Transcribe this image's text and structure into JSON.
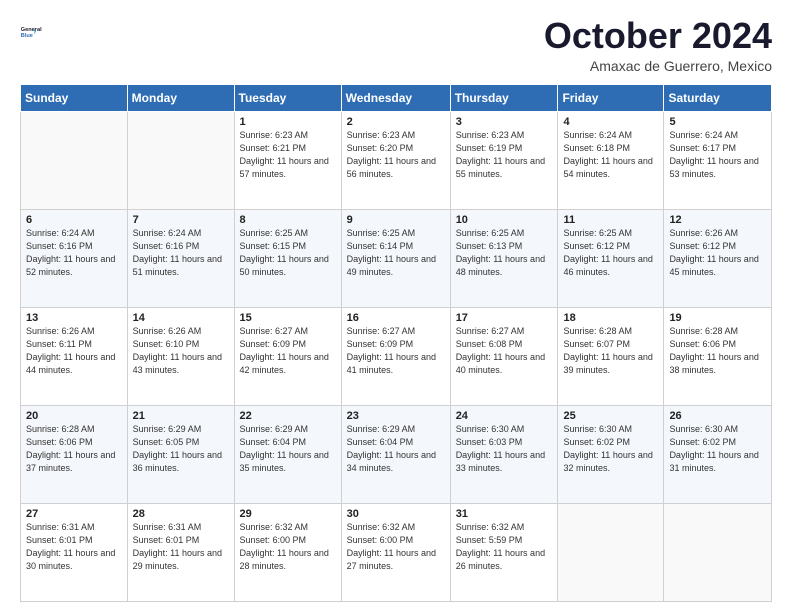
{
  "header": {
    "logo_line1": "General",
    "logo_line2": "Blue",
    "title": "October 2024",
    "subtitle": "Amaxac de Guerrero, Mexico"
  },
  "columns": [
    "Sunday",
    "Monday",
    "Tuesday",
    "Wednesday",
    "Thursday",
    "Friday",
    "Saturday"
  ],
  "weeks": [
    [
      {
        "day": "",
        "sunrise": "",
        "sunset": "",
        "daylight": ""
      },
      {
        "day": "",
        "sunrise": "",
        "sunset": "",
        "daylight": ""
      },
      {
        "day": "1",
        "sunrise": "Sunrise: 6:23 AM",
        "sunset": "Sunset: 6:21 PM",
        "daylight": "Daylight: 11 hours and 57 minutes."
      },
      {
        "day": "2",
        "sunrise": "Sunrise: 6:23 AM",
        "sunset": "Sunset: 6:20 PM",
        "daylight": "Daylight: 11 hours and 56 minutes."
      },
      {
        "day": "3",
        "sunrise": "Sunrise: 6:23 AM",
        "sunset": "Sunset: 6:19 PM",
        "daylight": "Daylight: 11 hours and 55 minutes."
      },
      {
        "day": "4",
        "sunrise": "Sunrise: 6:24 AM",
        "sunset": "Sunset: 6:18 PM",
        "daylight": "Daylight: 11 hours and 54 minutes."
      },
      {
        "day": "5",
        "sunrise": "Sunrise: 6:24 AM",
        "sunset": "Sunset: 6:17 PM",
        "daylight": "Daylight: 11 hours and 53 minutes."
      }
    ],
    [
      {
        "day": "6",
        "sunrise": "Sunrise: 6:24 AM",
        "sunset": "Sunset: 6:16 PM",
        "daylight": "Daylight: 11 hours and 52 minutes."
      },
      {
        "day": "7",
        "sunrise": "Sunrise: 6:24 AM",
        "sunset": "Sunset: 6:16 PM",
        "daylight": "Daylight: 11 hours and 51 minutes."
      },
      {
        "day": "8",
        "sunrise": "Sunrise: 6:25 AM",
        "sunset": "Sunset: 6:15 PM",
        "daylight": "Daylight: 11 hours and 50 minutes."
      },
      {
        "day": "9",
        "sunrise": "Sunrise: 6:25 AM",
        "sunset": "Sunset: 6:14 PM",
        "daylight": "Daylight: 11 hours and 49 minutes."
      },
      {
        "day": "10",
        "sunrise": "Sunrise: 6:25 AM",
        "sunset": "Sunset: 6:13 PM",
        "daylight": "Daylight: 11 hours and 48 minutes."
      },
      {
        "day": "11",
        "sunrise": "Sunrise: 6:25 AM",
        "sunset": "Sunset: 6:12 PM",
        "daylight": "Daylight: 11 hours and 46 minutes."
      },
      {
        "day": "12",
        "sunrise": "Sunrise: 6:26 AM",
        "sunset": "Sunset: 6:12 PM",
        "daylight": "Daylight: 11 hours and 45 minutes."
      }
    ],
    [
      {
        "day": "13",
        "sunrise": "Sunrise: 6:26 AM",
        "sunset": "Sunset: 6:11 PM",
        "daylight": "Daylight: 11 hours and 44 minutes."
      },
      {
        "day": "14",
        "sunrise": "Sunrise: 6:26 AM",
        "sunset": "Sunset: 6:10 PM",
        "daylight": "Daylight: 11 hours and 43 minutes."
      },
      {
        "day": "15",
        "sunrise": "Sunrise: 6:27 AM",
        "sunset": "Sunset: 6:09 PM",
        "daylight": "Daylight: 11 hours and 42 minutes."
      },
      {
        "day": "16",
        "sunrise": "Sunrise: 6:27 AM",
        "sunset": "Sunset: 6:09 PM",
        "daylight": "Daylight: 11 hours and 41 minutes."
      },
      {
        "day": "17",
        "sunrise": "Sunrise: 6:27 AM",
        "sunset": "Sunset: 6:08 PM",
        "daylight": "Daylight: 11 hours and 40 minutes."
      },
      {
        "day": "18",
        "sunrise": "Sunrise: 6:28 AM",
        "sunset": "Sunset: 6:07 PM",
        "daylight": "Daylight: 11 hours and 39 minutes."
      },
      {
        "day": "19",
        "sunrise": "Sunrise: 6:28 AM",
        "sunset": "Sunset: 6:06 PM",
        "daylight": "Daylight: 11 hours and 38 minutes."
      }
    ],
    [
      {
        "day": "20",
        "sunrise": "Sunrise: 6:28 AM",
        "sunset": "Sunset: 6:06 PM",
        "daylight": "Daylight: 11 hours and 37 minutes."
      },
      {
        "day": "21",
        "sunrise": "Sunrise: 6:29 AM",
        "sunset": "Sunset: 6:05 PM",
        "daylight": "Daylight: 11 hours and 36 minutes."
      },
      {
        "day": "22",
        "sunrise": "Sunrise: 6:29 AM",
        "sunset": "Sunset: 6:04 PM",
        "daylight": "Daylight: 11 hours and 35 minutes."
      },
      {
        "day": "23",
        "sunrise": "Sunrise: 6:29 AM",
        "sunset": "Sunset: 6:04 PM",
        "daylight": "Daylight: 11 hours and 34 minutes."
      },
      {
        "day": "24",
        "sunrise": "Sunrise: 6:30 AM",
        "sunset": "Sunset: 6:03 PM",
        "daylight": "Daylight: 11 hours and 33 minutes."
      },
      {
        "day": "25",
        "sunrise": "Sunrise: 6:30 AM",
        "sunset": "Sunset: 6:02 PM",
        "daylight": "Daylight: 11 hours and 32 minutes."
      },
      {
        "day": "26",
        "sunrise": "Sunrise: 6:30 AM",
        "sunset": "Sunset: 6:02 PM",
        "daylight": "Daylight: 11 hours and 31 minutes."
      }
    ],
    [
      {
        "day": "27",
        "sunrise": "Sunrise: 6:31 AM",
        "sunset": "Sunset: 6:01 PM",
        "daylight": "Daylight: 11 hours and 30 minutes."
      },
      {
        "day": "28",
        "sunrise": "Sunrise: 6:31 AM",
        "sunset": "Sunset: 6:01 PM",
        "daylight": "Daylight: 11 hours and 29 minutes."
      },
      {
        "day": "29",
        "sunrise": "Sunrise: 6:32 AM",
        "sunset": "Sunset: 6:00 PM",
        "daylight": "Daylight: 11 hours and 28 minutes."
      },
      {
        "day": "30",
        "sunrise": "Sunrise: 6:32 AM",
        "sunset": "Sunset: 6:00 PM",
        "daylight": "Daylight: 11 hours and 27 minutes."
      },
      {
        "day": "31",
        "sunrise": "Sunrise: 6:32 AM",
        "sunset": "Sunset: 5:59 PM",
        "daylight": "Daylight: 11 hours and 26 minutes."
      },
      {
        "day": "",
        "sunrise": "",
        "sunset": "",
        "daylight": ""
      },
      {
        "day": "",
        "sunrise": "",
        "sunset": "",
        "daylight": ""
      }
    ]
  ]
}
